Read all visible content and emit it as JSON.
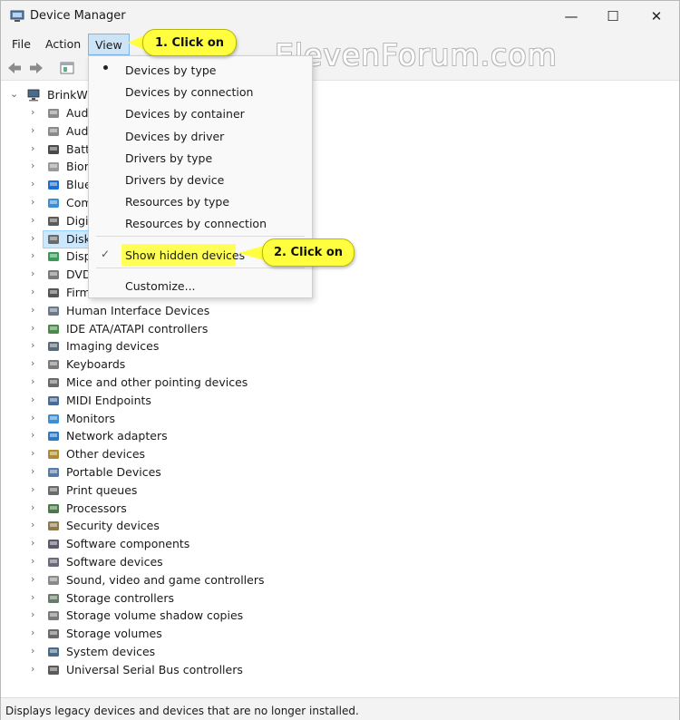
{
  "window": {
    "title": "Device Manager",
    "min_glyph": "—",
    "max_glyph": "☐",
    "close_glyph": "✕"
  },
  "menubar": {
    "file": "File",
    "action": "Action",
    "view": "View"
  },
  "watermark": "ElevenForum.com",
  "tree": {
    "root_label": "BrinkW",
    "items": [
      {
        "label": "Aud",
        "icon": "speaker-icon"
      },
      {
        "label": "Aud",
        "icon": "speaker-icon"
      },
      {
        "label": "Batt",
        "icon": "battery-icon"
      },
      {
        "label": "Bior",
        "icon": "fingerprint-icon"
      },
      {
        "label": "Blue",
        "icon": "bluetooth-icon"
      },
      {
        "label": "Com",
        "icon": "monitor-icon"
      },
      {
        "label": "Digi",
        "icon": "tablet-icon"
      },
      {
        "label": "Disk",
        "icon": "disk-drive-icon"
      },
      {
        "label": "Disp",
        "icon": "display-adapter-icon"
      },
      {
        "label": "DVD",
        "icon": "dvd-drive-icon"
      },
      {
        "label": "Firm",
        "icon": "firmware-icon"
      },
      {
        "label": "Human Interface Devices",
        "icon": "hid-icon"
      },
      {
        "label": "IDE ATA/ATAPI controllers",
        "icon": "ide-controller-icon"
      },
      {
        "label": "Imaging devices",
        "icon": "camera-icon"
      },
      {
        "label": "Keyboards",
        "icon": "keyboard-icon"
      },
      {
        "label": "Mice and other pointing devices",
        "icon": "mouse-icon"
      },
      {
        "label": "MIDI Endpoints",
        "icon": "midi-icon"
      },
      {
        "label": "Monitors",
        "icon": "monitor-icon"
      },
      {
        "label": "Network adapters",
        "icon": "network-icon"
      },
      {
        "label": "Other devices",
        "icon": "unknown-device-icon"
      },
      {
        "label": "Portable Devices",
        "icon": "portable-device-icon"
      },
      {
        "label": "Print queues",
        "icon": "printer-icon"
      },
      {
        "label": "Processors",
        "icon": "processor-icon"
      },
      {
        "label": "Security devices",
        "icon": "security-icon"
      },
      {
        "label": "Software components",
        "icon": "software-component-icon"
      },
      {
        "label": "Software devices",
        "icon": "software-device-icon"
      },
      {
        "label": "Sound, video and game controllers",
        "icon": "sound-icon"
      },
      {
        "label": "Storage controllers",
        "icon": "storage-controller-icon"
      },
      {
        "label": "Storage volume shadow copies",
        "icon": "shadow-copy-icon"
      },
      {
        "label": "Storage volumes",
        "icon": "volume-icon"
      },
      {
        "label": "System devices",
        "icon": "system-device-icon"
      },
      {
        "label": "Universal Serial Bus controllers",
        "icon": "usb-icon"
      }
    ]
  },
  "view_menu": {
    "items": [
      "Devices by type",
      "Devices by connection",
      "Devices by container",
      "Devices by driver",
      "Drivers by type",
      "Drivers by device",
      "Resources by type",
      "Resources by connection"
    ],
    "show_hidden": "Show hidden devices",
    "customize": "Customize...",
    "check_glyph": "✓"
  },
  "callouts": {
    "one": "1. Click on",
    "two": "2. Click on"
  },
  "status": "Displays legacy devices and devices that are no longer installed.",
  "colors": {
    "highlight": "#ffff55",
    "callout": "#ffff40",
    "menu_active": "#cde4f7",
    "selection": "#cce8ff"
  }
}
